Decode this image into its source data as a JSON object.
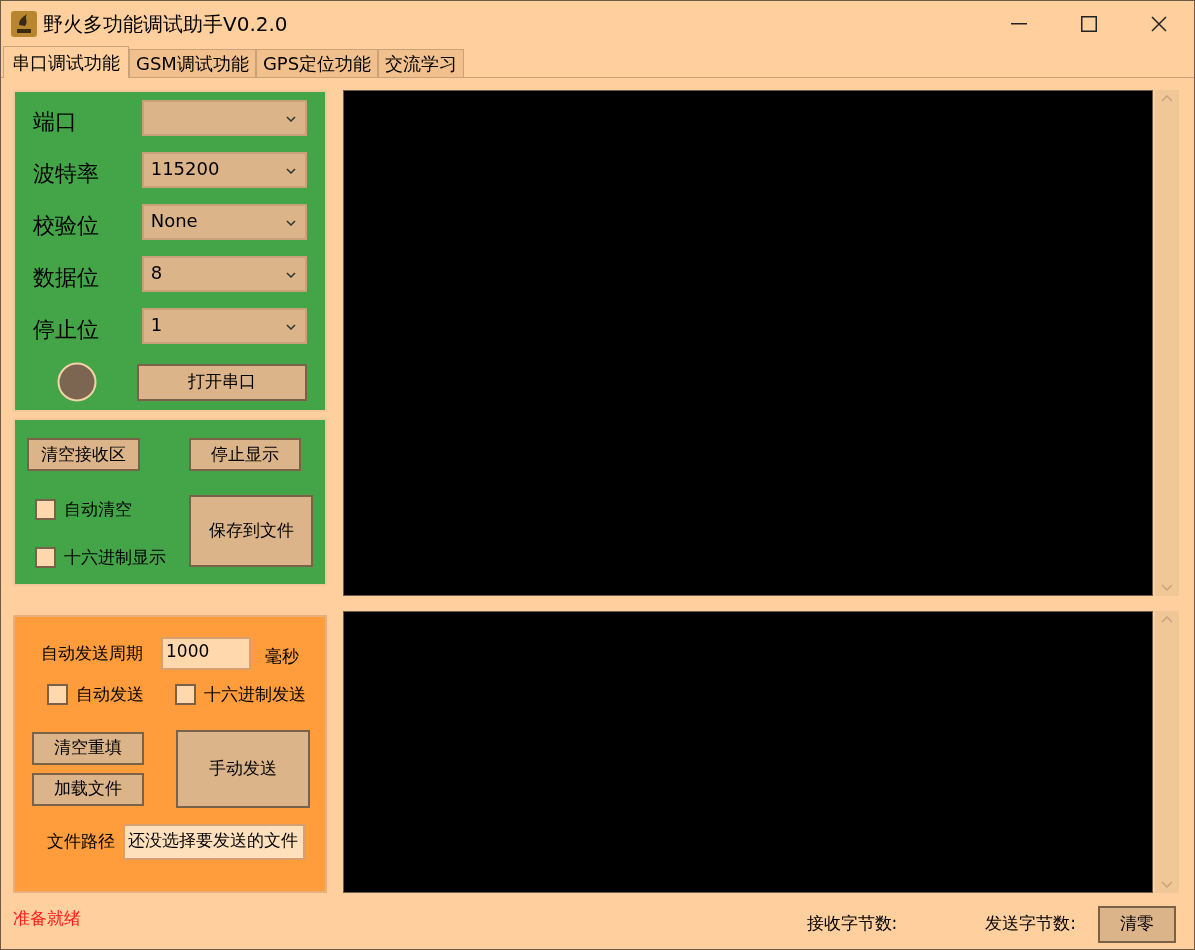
{
  "window": {
    "title": "野火多功能调试助手V0.2.0"
  },
  "tabs": [
    {
      "label": "串口调试功能",
      "selected": true
    },
    {
      "label": "GSM调试功能",
      "selected": false
    },
    {
      "label": "GPS定位功能",
      "selected": false
    },
    {
      "label": "交流学习",
      "selected": false
    }
  ],
  "serial_settings": [
    {
      "label": "端口"
    },
    {
      "label": "波特率",
      "value": "115200"
    },
    {
      "label": "校验位",
      "value": "None"
    },
    {
      "label": "数据位",
      "value": "8"
    },
    {
      "label": "停止位",
      "value": "1"
    }
  ],
  "open_button": "打开串口",
  "receive_panel": {
    "clear_button": "清空接收区",
    "stop_button": "停止显示",
    "save_button": "保存到文件",
    "options": [
      {
        "label": "自动清空",
        "checked": false
      },
      {
        "label": "十六进制显示",
        "checked": false
      }
    ]
  },
  "send_panel": {
    "period_label": "自动发送周期",
    "period_value": "1000",
    "period_unit": "毫秒",
    "options": [
      {
        "label": "自动发送",
        "checked": false
      },
      {
        "label": "十六进制发送",
        "checked": false
      }
    ],
    "clear_button": "清空重填",
    "load_button": "加载文件",
    "send_button": "手动发送",
    "path_label": "文件路径",
    "path_value": "还没选择要发送的文件"
  },
  "status_bar": {
    "status": "准备就绪",
    "received_label": "接收字节数:",
    "sent_label": "发送字节数:",
    "reset_button": "清零"
  }
}
